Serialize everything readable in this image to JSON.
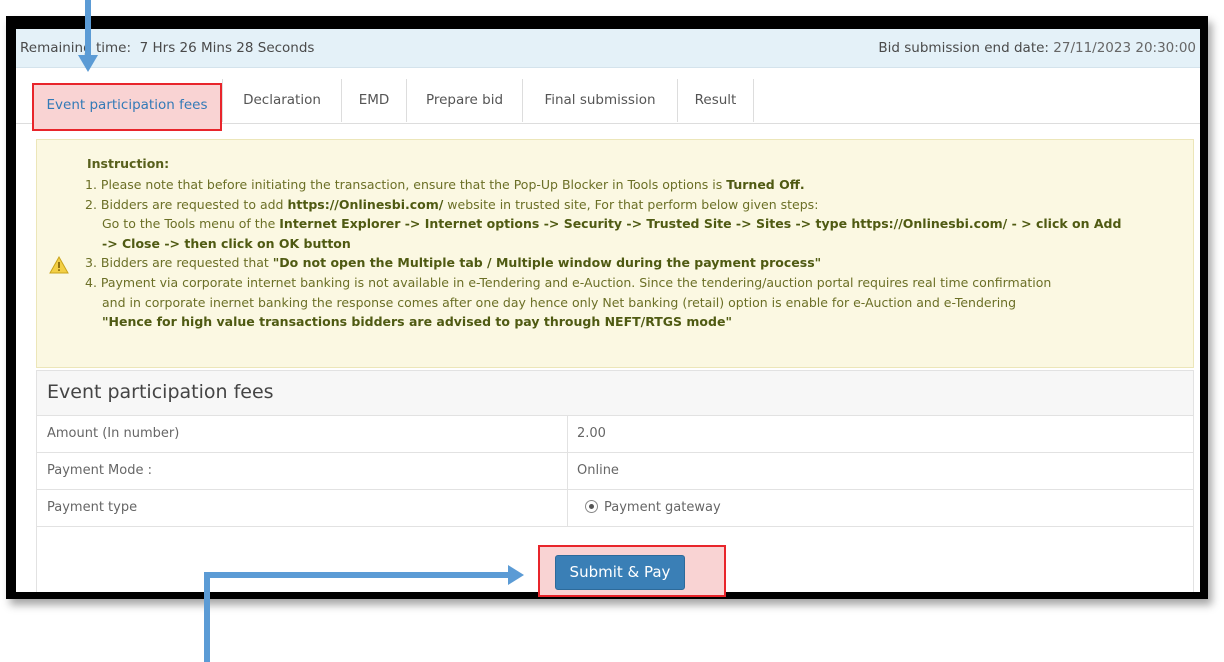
{
  "timebar": {
    "remaining_label": "Remaining time:",
    "remaining_value": "7 Hrs 26 Mins 28 Seconds",
    "end_label": "Bid submission end date:",
    "end_value": "27/11/2023 20:30:00"
  },
  "tabs": [
    {
      "label": "Event participation fees"
    },
    {
      "label": "Declaration"
    },
    {
      "label": "EMD"
    },
    {
      "label": "Prepare bid"
    },
    {
      "label": "Final submission"
    },
    {
      "label": "Result"
    }
  ],
  "instruction": {
    "title": "Instruction:",
    "l1_pre": "1. Please note that before initiating the transaction, ensure that the Pop-Up Blocker in Tools options is ",
    "l1_bold": "Turned Off.",
    "l2_a": "2. Bidders are requested to add ",
    "l2_url": "https://Onlinesbi.com/",
    "l2_b": " website in trusted site, For that perform below given steps:",
    "l3_a": "Go to the Tools menu of the ",
    "l3_bold": "Internet Explorer -> Internet options -> Security -> Trusted Site -> Sites -> type https://Onlinesbi.com/ - > click on Add",
    "l4_bold": "-> Close -> then click on OK button",
    "l5_a": "3. Bidders are requested that ",
    "l5_bold": "\"Do not open the Multiple tab / Multiple window during the payment process\"",
    "l6": "4. Payment via corporate internet banking is not available in e-Tendering and e-Auction. Since the tendering/auction portal requires real time confirmation",
    "l7": "and in corporate inernet banking the response comes after one day hence only Net banking (retail) option is enable for e-Auction and e-Tendering",
    "l8_bold": "\"Hence for high value transactions bidders are advised to pay through NEFT/RTGS mode\""
  },
  "fees": {
    "title": "Event participation fees",
    "rows": [
      {
        "label": "Amount (In number)",
        "value": "2.00"
      },
      {
        "label": "Payment Mode :",
        "value": "Online"
      },
      {
        "label": "Payment type",
        "value": "Payment gateway"
      }
    ],
    "submit_label": "Submit & Pay"
  },
  "colors": {
    "accent": "#3a7fb6",
    "highlight_border": "#e8252b",
    "highlight_fill": "#f9d3d3",
    "instruction_bg": "#fbf8e2",
    "arrow": "#5b9bd5"
  }
}
